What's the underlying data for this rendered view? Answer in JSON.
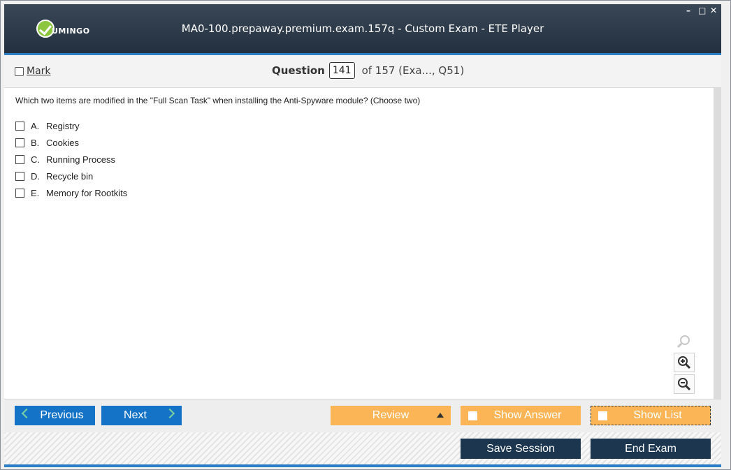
{
  "window": {
    "title": "MA0-100.prepaway.premium.exam.157q - Custom Exam - ETE Player",
    "logo_text": "UMINGO",
    "controls": {
      "minimize": "–",
      "maximize": "□",
      "close": "✕"
    }
  },
  "question_bar": {
    "mark_label": "Mark",
    "question_label": "Question",
    "question_number": "141",
    "question_total": "of 157 (Exa..., Q51)"
  },
  "question": {
    "text": "Which two items are modified in the \"Full Scan Task\" when installing the Anti-Spyware module? (Choose two)",
    "options": [
      {
        "letter": "A.",
        "text": "Registry"
      },
      {
        "letter": "B.",
        "text": "Cookies"
      },
      {
        "letter": "C.",
        "text": "Running Process"
      },
      {
        "letter": "D.",
        "text": "Recycle bin"
      },
      {
        "letter": "E.",
        "text": "Memory for Rootkits"
      }
    ]
  },
  "zoom": {
    "icons": [
      "search-icon",
      "zoom-in-icon",
      "zoom-out-icon"
    ]
  },
  "nav": {
    "previous_label": "Previous",
    "next_label": "Next",
    "review_label": "Review",
    "show_answer_label": "Show Answer",
    "show_list_label": "Show List"
  },
  "footer": {
    "save_session_label": "Save Session",
    "end_exam_label": "End Exam"
  },
  "colors": {
    "header": "#223040",
    "accent": "#2b7fc4",
    "nav_blue": "#1473c6",
    "orange": "#fbb556",
    "navy": "#1c3650"
  }
}
